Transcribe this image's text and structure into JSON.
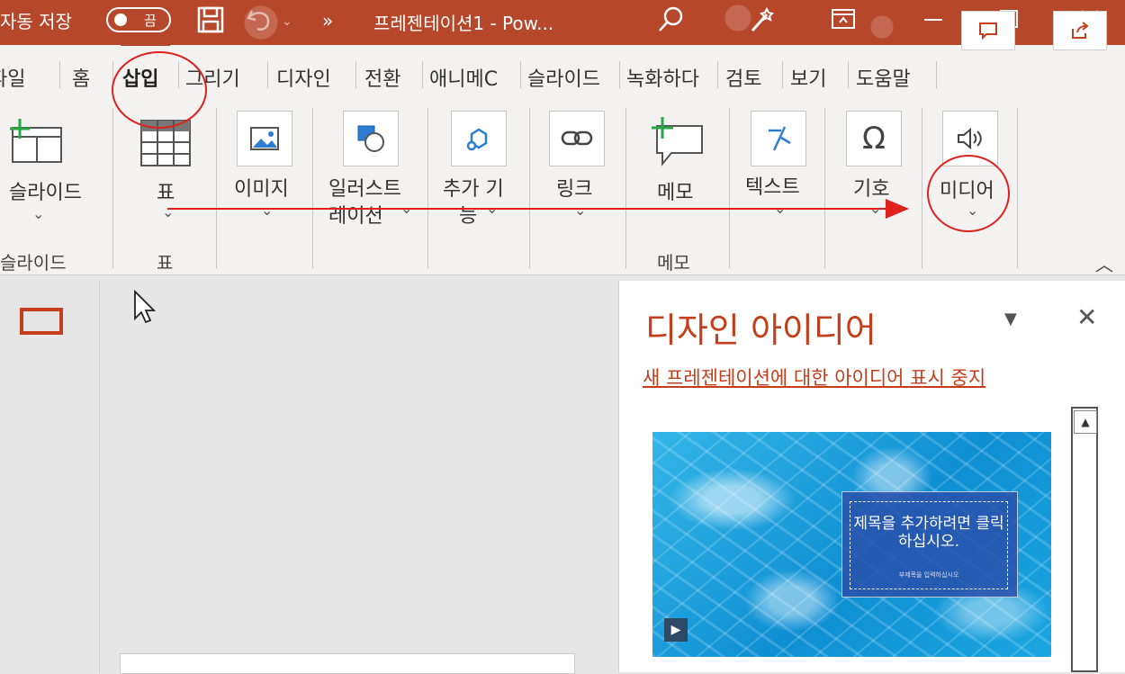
{
  "titlebar": {
    "autosave_label": "자동 저장",
    "autosave_state": "끔",
    "more": "»",
    "doc_title": "프레젠테이션1 - Pow..."
  },
  "tabs": [
    "파일",
    "홈",
    "삽입",
    "그리기",
    "디자인",
    "전환",
    "애니메이션",
    "슬라이드",
    "녹화하다",
    "검토",
    "보기",
    "도움말"
  ],
  "tab_display": [
    "파일",
    "홈",
    "삽입",
    "그리기",
    "디자인",
    "전환",
    "애니메C",
    "슬라이드",
    "녹화하다",
    "검토",
    "보기",
    "도움말"
  ],
  "active_tab": "삽입",
  "ribbon": {
    "slide_label": "슬라이드",
    "slide_group": "슬라이드",
    "table_label": "표",
    "table_group": "표",
    "image_label": "이미지",
    "illust_label_1": "일러스트",
    "illust_label_2": "레이션",
    "addin_label_1": "추가 기",
    "addin_label_2": "능",
    "link_label": "링크",
    "memo_label": "메모",
    "memo_group": "메모",
    "text_label": "텍스트",
    "symbol_label": "기호",
    "media_label": "미디어"
  },
  "designer": {
    "title": "디자인 아이디어",
    "stop_link": "새 프레젠테이션에 대한 아이디어 표시 중지",
    "preview_title": "제목을 추가하려면 클릭하십시오.",
    "preview_sub": "부제목을 입력하십시오"
  },
  "colors": {
    "accent": "#b7472a",
    "annotation": "#e0201c"
  }
}
